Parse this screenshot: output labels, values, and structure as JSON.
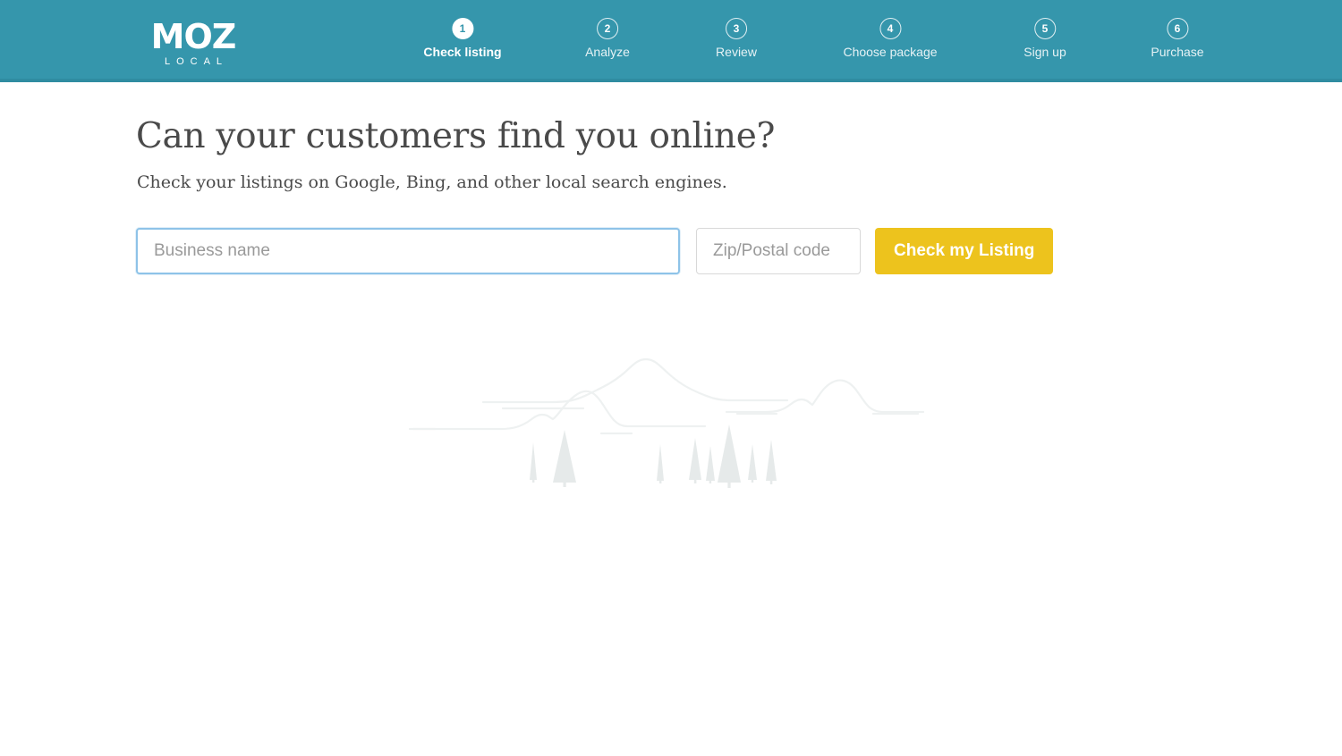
{
  "header": {
    "background_color": "#3596ac",
    "logo": {
      "mark": "MOZ",
      "sub": "LOCAL"
    },
    "steps": [
      {
        "number": "1",
        "label": "Check listing",
        "active": true
      },
      {
        "number": "2",
        "label": "Analyze",
        "active": false
      },
      {
        "number": "3",
        "label": "Review",
        "active": false
      },
      {
        "number": "4",
        "label": "Choose package",
        "active": false
      },
      {
        "number": "5",
        "label": "Sign up",
        "active": false
      },
      {
        "number": "6",
        "label": "Purchase",
        "active": false
      }
    ]
  },
  "main": {
    "headline": "Can your customers find you online?",
    "subhead": "Check your listings on Google, Bing, and other local search engines.",
    "form": {
      "business_name": {
        "value": "",
        "placeholder": "Business name"
      },
      "zip": {
        "value": "",
        "placeholder": "Zip/Postal code"
      },
      "submit_label": "Check my Listing",
      "submit_color": "#edc31d",
      "focus_border_color": "#8ec3e8"
    }
  },
  "illustration": {
    "name": "landscape-hills-trees",
    "stroke_color": "#eef1f1",
    "tree_color": "#e6eaea"
  }
}
